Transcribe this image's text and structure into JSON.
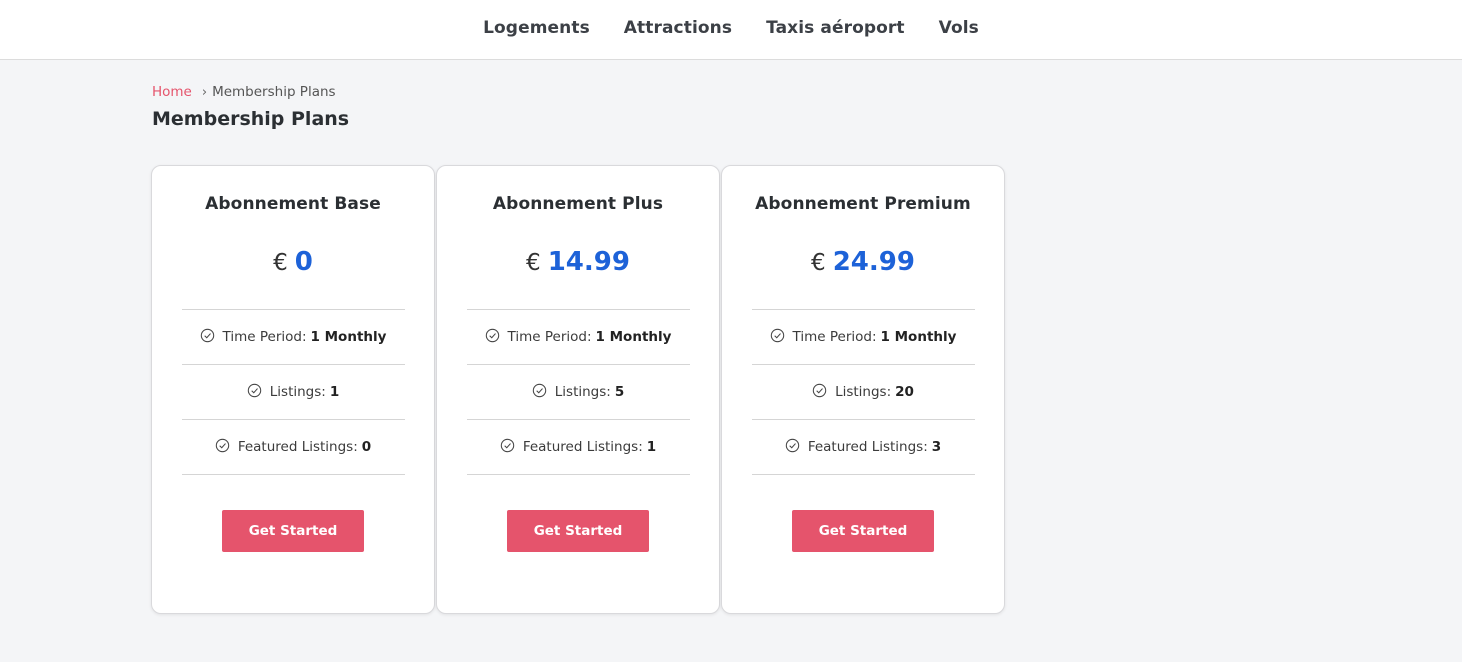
{
  "nav": {
    "items": [
      "Logements",
      "Attractions",
      "Taxis aéroport",
      "Vols"
    ]
  },
  "breadcrumb": {
    "home": "Home",
    "separator": "›",
    "current": "Membership Plans"
  },
  "page_title": "Membership Plans",
  "colors": {
    "accent": "#e5546c",
    "price": "#1d62d8"
  },
  "plans": [
    {
      "name": "Abonnement Base",
      "currency": "€",
      "price": "0",
      "features": [
        {
          "label": "Time Period:",
          "value": "1 Monthly"
        },
        {
          "label": "Listings:",
          "value": "1"
        },
        {
          "label": "Featured Listings:",
          "value": "0"
        }
      ],
      "button": "Get Started"
    },
    {
      "name": "Abonnement Plus",
      "currency": "€",
      "price": "14.99",
      "features": [
        {
          "label": "Time Period:",
          "value": "1 Monthly"
        },
        {
          "label": "Listings:",
          "value": "5"
        },
        {
          "label": "Featured Listings:",
          "value": "1"
        }
      ],
      "button": "Get Started"
    },
    {
      "name": "Abonnement Premium",
      "currency": "€",
      "price": "24.99",
      "features": [
        {
          "label": "Time Period:",
          "value": "1 Monthly"
        },
        {
          "label": "Listings:",
          "value": "20"
        },
        {
          "label": "Featured Listings:",
          "value": "3"
        }
      ],
      "button": "Get Started"
    }
  ]
}
